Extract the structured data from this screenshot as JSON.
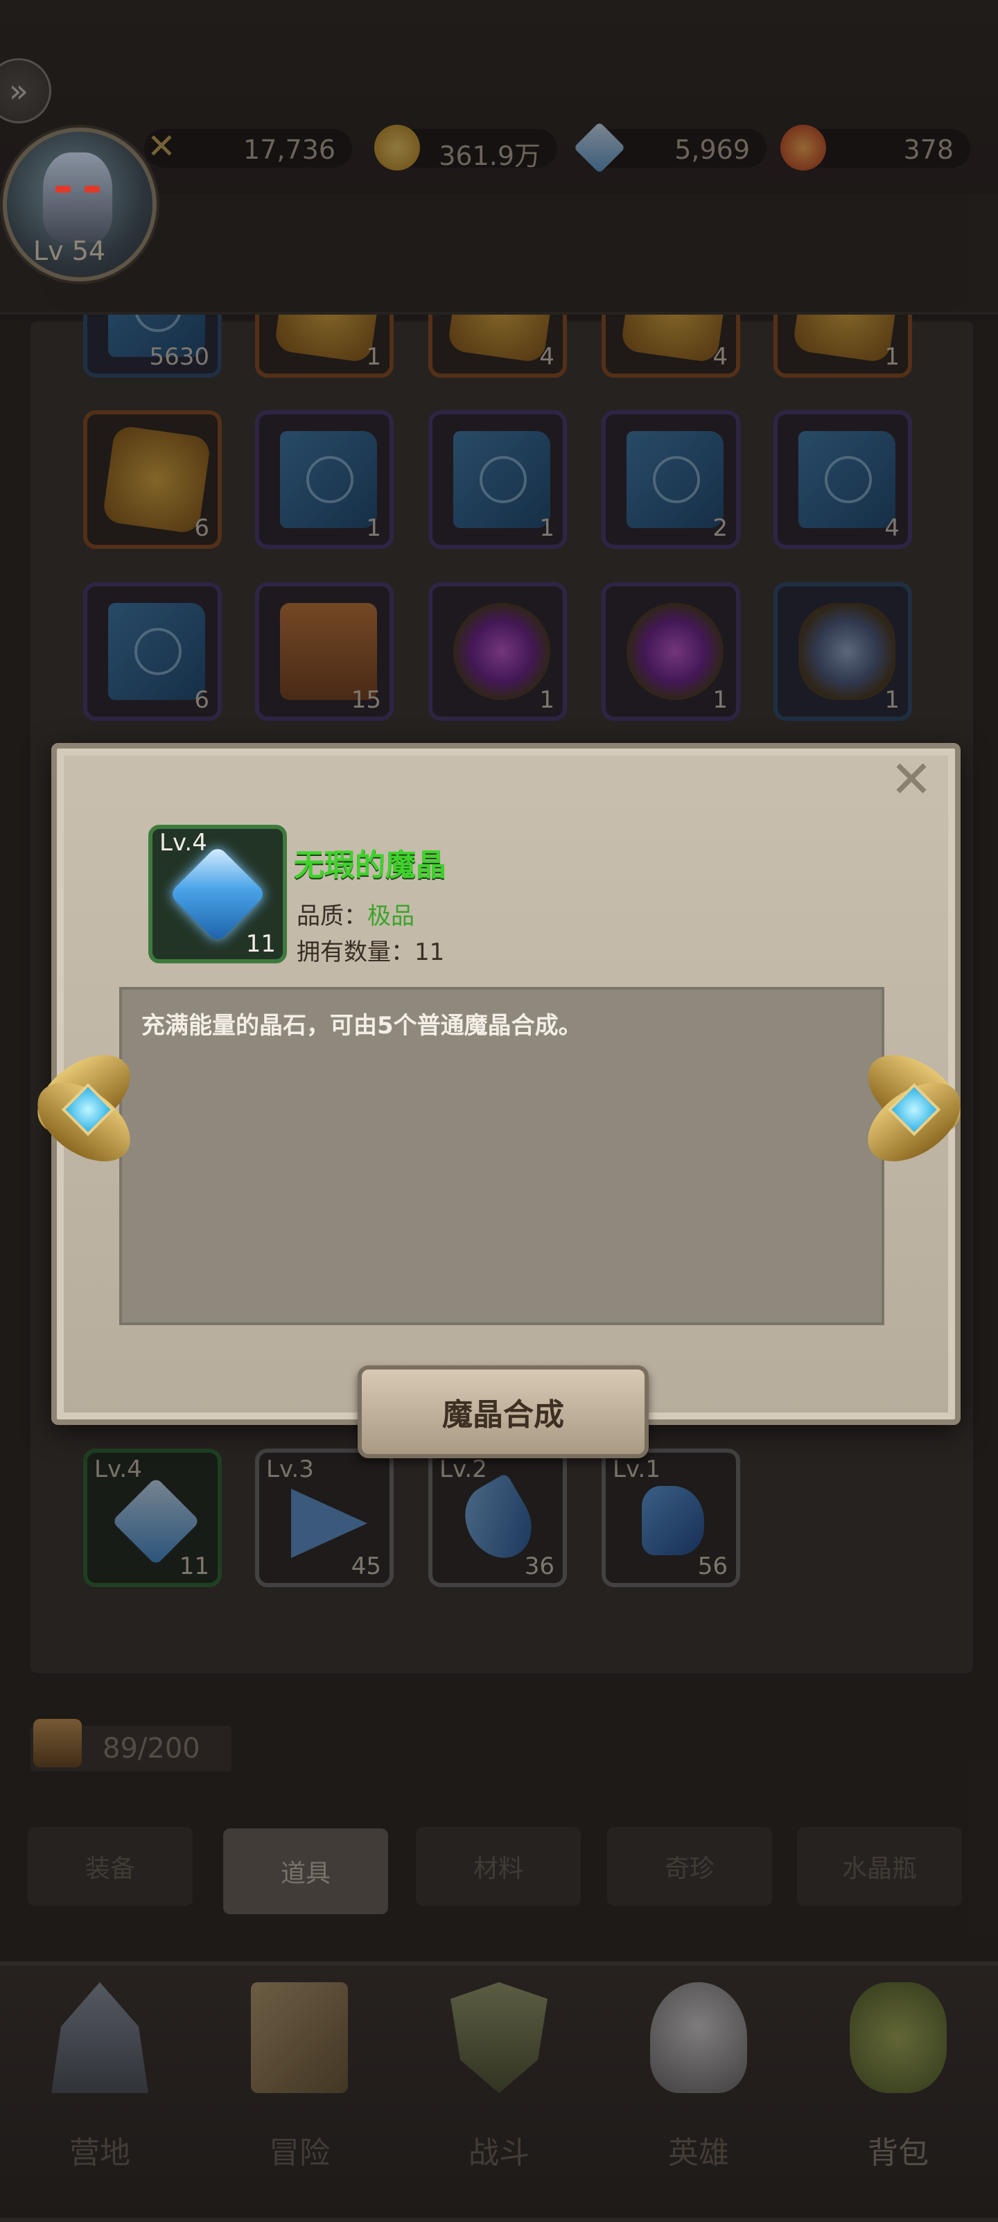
{
  "player": {
    "level": "Lv 54"
  },
  "resources": [
    {
      "name": "power",
      "value": "17,736",
      "color": "#c9a95a"
    },
    {
      "name": "gold",
      "value": "361.9万",
      "color": "#e3b83a"
    },
    {
      "name": "diamond",
      "value": "5,969",
      "color": "#7fb6e0"
    },
    {
      "name": "orb",
      "value": "378",
      "color": "#e0652a"
    }
  ],
  "inventory": {
    "row0": [
      "5630",
      "1",
      "4",
      "4",
      "1"
    ],
    "row1": [
      "6",
      "1",
      "1",
      "2",
      "4"
    ],
    "row2": [
      "6",
      "15",
      "1",
      "1",
      "1"
    ],
    "gems": [
      {
        "lv": "Lv.4",
        "count": "11"
      },
      {
        "lv": "Lv.3",
        "count": "45"
      },
      {
        "lv": "Lv.2",
        "count": "36"
      },
      {
        "lv": "Lv.1",
        "count": "56"
      }
    ]
  },
  "popup": {
    "item_level": "Lv.4",
    "item_count": "11",
    "item_name": "无瑕的魔晶",
    "quality_label": "品质：",
    "quality_value": "极品",
    "owned_label": "拥有数量：",
    "owned_value": "11",
    "description": "充满能量的晶石，可由5个普通魔晶合成。",
    "action_label": "魔晶合成",
    "close_glyph": "✕"
  },
  "capacity": "89/200",
  "tabs": [
    {
      "label": "装备",
      "active": false
    },
    {
      "label": "道具",
      "active": true
    },
    {
      "label": "材料",
      "active": false
    },
    {
      "label": "奇珍",
      "active": false
    },
    {
      "label": "水晶瓶",
      "active": false
    }
  ],
  "nav": [
    {
      "label": "营地",
      "icon": "camp-icon"
    },
    {
      "label": "冒险",
      "icon": "adventure-map-icon"
    },
    {
      "label": "战斗",
      "icon": "battle-shield-icon"
    },
    {
      "label": "英雄",
      "icon": "hero-helmet-icon"
    },
    {
      "label": "背包",
      "icon": "backpack-icon"
    }
  ]
}
